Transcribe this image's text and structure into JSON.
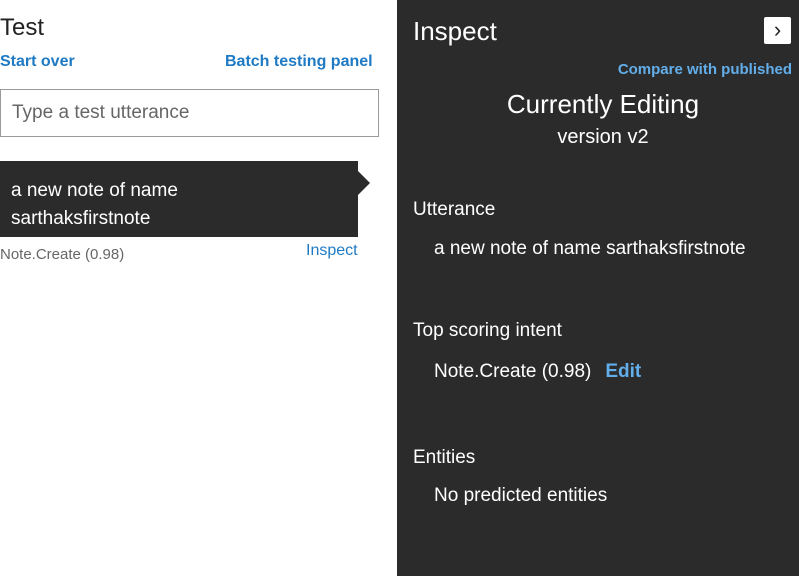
{
  "test_panel": {
    "title": "Test",
    "start_over": "Start over",
    "batch_testing": "Batch testing panel",
    "input_placeholder": "Type a test utterance",
    "card_text_line1": "a new note of name",
    "card_text_line2": "sarthaksfirstnote",
    "result": "Note.Create (0.98)",
    "inspect": "Inspect"
  },
  "inspect_panel": {
    "title": "Inspect",
    "collapse_icon": "chevron-right-icon",
    "compare": "Compare with published",
    "currently_editing": "Currently Editing",
    "version": "version v2",
    "utterance_label": "Utterance",
    "utterance_value": "a new note of name sarthaksfirstnote",
    "top_intent_label": "Top scoring intent",
    "top_intent_value": "Note.Create (0.98)",
    "edit": "Edit",
    "entities_label": "Entities",
    "entities_value": "No predicted entities"
  },
  "colors": {
    "accent": "#1e7ac4",
    "panel_dark": "#2b2b2b",
    "accent_on_dark": "#62aeea"
  }
}
